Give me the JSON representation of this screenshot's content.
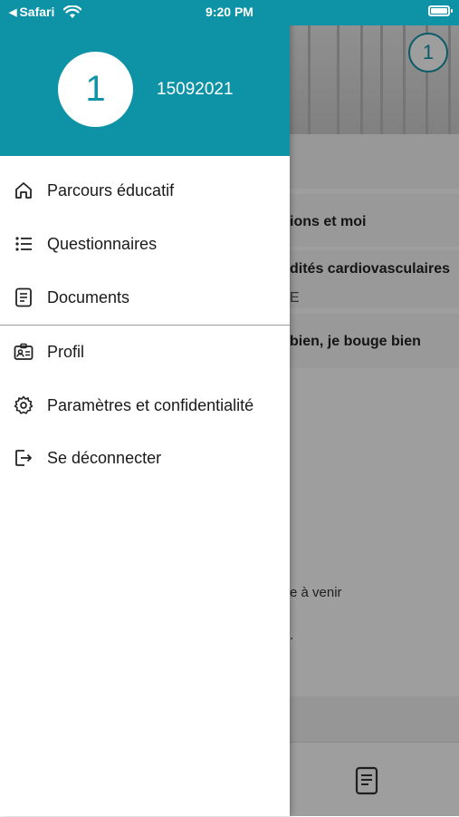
{
  "status_bar": {
    "back_app": "Safari",
    "time": "9:20 PM"
  },
  "drawer": {
    "avatar_initial": "1",
    "user_id": "15092021",
    "menu": [
      {
        "label": "Parcours éducatif",
        "icon": "home-icon"
      },
      {
        "label": "Questionnaires",
        "icon": "list-icon"
      },
      {
        "label": "Documents",
        "icon": "document-icon"
      },
      {
        "label": "Profil",
        "icon": "id-card-icon"
      },
      {
        "label": "Paramètres et confidentialité",
        "icon": "gear-icon"
      },
      {
        "label": "Se déconnecter",
        "icon": "logout-icon"
      }
    ]
  },
  "background": {
    "avatar_initial": "1",
    "card1": "ions et moi",
    "card2_title": "dités cardiovasculaires",
    "card2_sub": "E",
    "card3": "bien, je bouge bien",
    "upcoming_text": "e à venir",
    "dot_text": "."
  },
  "colors": {
    "brand": "#0e93a6"
  }
}
